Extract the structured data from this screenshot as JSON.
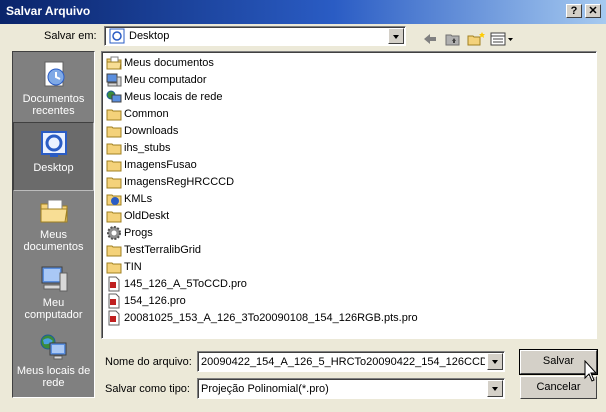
{
  "window": {
    "title": "Salvar Arquivo",
    "help_label": "?",
    "close_label": "✕"
  },
  "location": {
    "label": "Salvar em:",
    "value": "Desktop"
  },
  "places": [
    {
      "label": "Documentos recentes",
      "icon": "recent-documents-icon"
    },
    {
      "label": "Desktop",
      "icon": "desktop-icon"
    },
    {
      "label": "Meus documentos",
      "icon": "my-documents-icon"
    },
    {
      "label": "Meu computador",
      "icon": "my-computer-icon"
    },
    {
      "label": "Meus locais de rede",
      "icon": "network-places-icon"
    }
  ],
  "files": [
    {
      "name": "Meus documentos",
      "icon": "my-documents"
    },
    {
      "name": "Meu computador",
      "icon": "computer"
    },
    {
      "name": "Meus locais de rede",
      "icon": "network"
    },
    {
      "name": "Common",
      "icon": "folder"
    },
    {
      "name": "Downloads",
      "icon": "folder"
    },
    {
      "name": "ihs_stubs",
      "icon": "folder"
    },
    {
      "name": "ImagensFusao",
      "icon": "folder"
    },
    {
      "name": "ImagensRegHRCCCD",
      "icon": "folder"
    },
    {
      "name": "KMLs",
      "icon": "kml"
    },
    {
      "name": "OldDeskt",
      "icon": "folder"
    },
    {
      "name": "Progs",
      "icon": "gear"
    },
    {
      "name": "TestTerralibGrid",
      "icon": "folder"
    },
    {
      "name": "TIN",
      "icon": "folder"
    },
    {
      "name": "145_126_A_5ToCCD.pro",
      "icon": "file"
    },
    {
      "name": "154_126.pro",
      "icon": "file"
    },
    {
      "name": "20081025_153_A_126_3To20090108_154_126RGB.pts.pro",
      "icon": "file"
    }
  ],
  "filename": {
    "label": "Nome do arquivo:",
    "value": "20090422_154_A_126_5_HRCTo20090422_154_126CCD"
  },
  "filetype": {
    "label": "Salvar como tipo:",
    "value": "Projeção Polinomial(*.pro)"
  },
  "buttons": {
    "save": "Salvar",
    "cancel": "Cancelar"
  }
}
